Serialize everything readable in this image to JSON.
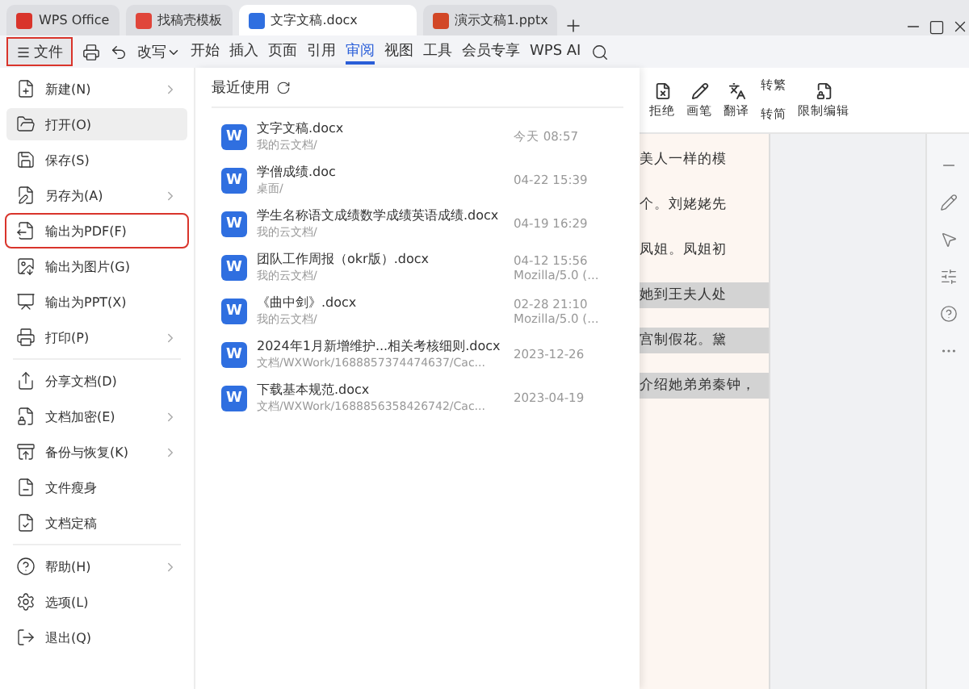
{
  "tabs": [
    {
      "label": "WPS Office",
      "kind": "home",
      "selected": false
    },
    {
      "label": "找稿壳模板",
      "kind": "template",
      "selected": false
    },
    {
      "label": "文字文稿.docx",
      "kind": "writer",
      "selected": true
    },
    {
      "label": "演示文稿1.pptx",
      "kind": "slides",
      "selected": false
    }
  ],
  "toolbar": {
    "file_button": {
      "label": "文件",
      "highlighted": true
    },
    "mode": "改写",
    "menus": [
      {
        "label": "开始",
        "selected": false
      },
      {
        "label": "插入",
        "selected": false
      },
      {
        "label": "页面",
        "selected": false
      },
      {
        "label": "引用",
        "selected": false
      },
      {
        "label": "审阅",
        "selected": true
      },
      {
        "label": "视图",
        "selected": false
      },
      {
        "label": "工具",
        "selected": false
      },
      {
        "label": "会员专享",
        "selected": false
      }
    ],
    "ai": "WPS AI"
  },
  "file_menu": [
    {
      "label": "新建(N)",
      "submenu": true,
      "selected": false,
      "highlighted": false,
      "divider_after": false
    },
    {
      "label": "打开(O)",
      "submenu": false,
      "selected": true,
      "highlighted": false,
      "divider_after": false
    },
    {
      "label": "保存(S)",
      "submenu": false,
      "selected": false,
      "highlighted": false,
      "divider_after": false
    },
    {
      "label": "另存为(A)",
      "submenu": true,
      "selected": false,
      "highlighted": false,
      "divider_after": false
    },
    {
      "label": "输出为PDF(F)",
      "submenu": false,
      "selected": false,
      "highlighted": true,
      "divider_after": false
    },
    {
      "label": "输出为图片(G)",
      "submenu": false,
      "selected": false,
      "highlighted": false,
      "divider_after": false
    },
    {
      "label": "输出为PPT(X)",
      "submenu": false,
      "selected": false,
      "highlighted": false,
      "divider_after": false
    },
    {
      "label": "打印(P)",
      "submenu": true,
      "selected": false,
      "highlighted": false,
      "divider_after": true
    },
    {
      "label": "分享文档(D)",
      "submenu": false,
      "selected": false,
      "highlighted": false,
      "divider_after": false
    },
    {
      "label": "文档加密(E)",
      "submenu": true,
      "selected": false,
      "highlighted": false,
      "divider_after": false
    },
    {
      "label": "备份与恢复(K)",
      "submenu": true,
      "selected": false,
      "highlighted": false,
      "divider_after": false
    },
    {
      "label": "文件瘦身",
      "submenu": false,
      "selected": false,
      "highlighted": false,
      "divider_after": false
    },
    {
      "label": "文档定稿",
      "submenu": false,
      "selected": false,
      "highlighted": false,
      "divider_after": true
    },
    {
      "label": "帮助(H)",
      "submenu": true,
      "selected": false,
      "highlighted": false,
      "divider_after": false
    },
    {
      "label": "选项(L)",
      "submenu": false,
      "selected": false,
      "highlighted": false,
      "divider_after": false
    },
    {
      "label": "退出(Q)",
      "submenu": false,
      "selected": false,
      "highlighted": false,
      "divider_after": false
    }
  ],
  "recent": {
    "title": "最近使用",
    "files": [
      {
        "icon_letter": "W",
        "name": "文字文稿.docx",
        "path": "我的云文档/",
        "time": "今天 08:57"
      },
      {
        "icon_letter": "W",
        "name": "学僧成绩.doc",
        "path": "桌面/",
        "time": "04-22 15:39"
      },
      {
        "icon_letter": "W",
        "name": "学生名称语文成绩数学成绩英语成绩.docx",
        "path": "我的云文档/",
        "time": "04-19 16:29"
      },
      {
        "icon_letter": "W",
        "name": "团队工作周报（okr版）.docx",
        "path": "我的云文档/",
        "time": "04-12 15:56",
        "source": "Mozilla/5.0 (..."
      },
      {
        "icon_letter": "W",
        "name": "《曲中剑》.docx",
        "path": "我的云文档/",
        "time": "02-28 21:10",
        "source": "Mozilla/5.0 (..."
      },
      {
        "icon_letter": "W",
        "name": "2024年1月新增维护...相关考核细则.docx",
        "path": "文档/WXWork/1688857374474637/Cac...",
        "time": "2023-12-26"
      },
      {
        "icon_letter": "W",
        "name": "下载基本规范.docx",
        "path": "文档/WXWork/1688856358426742/Cac...",
        "time": "2023-04-19"
      }
    ]
  },
  "ribbon": {
    "reject": "拒绝",
    "pen": "画笔",
    "translate": "翻译",
    "to_traditional": "转繁",
    "to_simplified": "转简",
    "restrict": "限制编辑"
  },
  "document_lines": [
    {
      "text": "美人一样的模",
      "shaded": false
    },
    {
      "text": "个。刘姥姥先",
      "shaded": false
    },
    {
      "text": "凤姐。凤姐初",
      "shaded": false
    },
    {
      "text": "她到王夫人处",
      "shaded": true
    },
    {
      "text": "宫制假花。黛",
      "shaded": true
    },
    {
      "text": "介绍她弟弟秦钟，",
      "shaded": true
    }
  ]
}
